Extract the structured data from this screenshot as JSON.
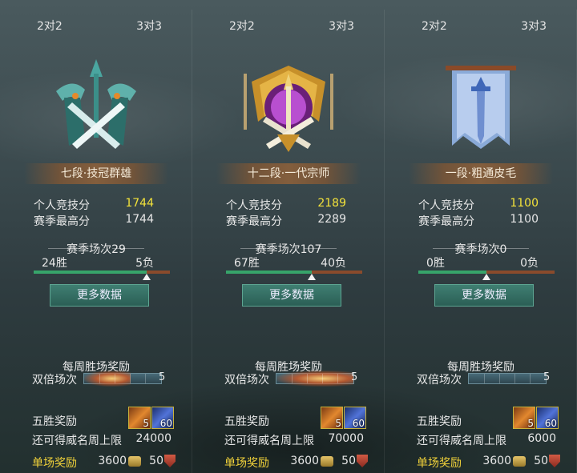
{
  "panels": [
    {
      "modes": [
        "2对2",
        "3对3"
      ],
      "rank": "七段·技冠群雄",
      "emblem": "crossed-swords-emblem",
      "score_label": "个人竞技分",
      "score": "1744",
      "max_label": "赛季最高分",
      "max_score": "1744",
      "season": "赛季场次29",
      "wins": "24胜",
      "losses": "5负",
      "win_ratio": 0.83,
      "more_button": "更多数据",
      "weekly_title": "每周胜场奖励",
      "double_label": "双倍场次",
      "double_count": "5",
      "double_progress": 0.6,
      "five_win_label": "五胜奖励",
      "item1_count": "5",
      "item2_count": "60",
      "cap_label": "还可得威名周上限",
      "cap_value": "24000",
      "single_label": "单场奖励",
      "coins": "3600",
      "shield": "50"
    },
    {
      "modes": [
        "2对2",
        "3对3"
      ],
      "rank": "十二段·一代宗师",
      "emblem": "golden-winged-emblem",
      "score_label": "个人竞技分",
      "score": "2189",
      "max_label": "赛季最高分",
      "max_score": "2289",
      "season": "赛季场次107",
      "wins": "67胜",
      "losses": "40负",
      "win_ratio": 0.63,
      "more_button": "更多数据",
      "weekly_title": "每周胜场奖励",
      "double_label": "双倍场次",
      "double_count": "5",
      "double_progress": 1.0,
      "five_win_label": "五胜奖励",
      "item1_count": "5",
      "item2_count": "60",
      "cap_label": "还可得威名周上限",
      "cap_value": "70000",
      "single_label": "单场奖励",
      "coins": "3600",
      "shield": "50"
    },
    {
      "modes": [
        "2对2",
        "3对3"
      ],
      "rank": "一段·粗通皮毛",
      "emblem": "sword-banner-emblem",
      "score_label": "个人竞技分",
      "score": "1100",
      "max_label": "赛季最高分",
      "max_score": "1100",
      "season": "赛季场次0",
      "wins": "0胜",
      "losses": "0负",
      "win_ratio": 0.5,
      "more_button": "更多数据",
      "weekly_title": "每周胜场奖励",
      "double_label": "双倍场次",
      "double_count": "5",
      "double_progress": 0.0,
      "five_win_label": "五胜奖励",
      "item1_count": "5",
      "item2_count": "60",
      "cap_label": "还可得威名周上限",
      "cap_value": "6000",
      "single_label": "单场奖励",
      "coins": "3600",
      "shield": "50"
    }
  ],
  "colors": {
    "score_highlight": "#f3e23a",
    "single_reward_label": "#f1d23a",
    "win_bar": "#37a46a",
    "loss_bar": "#8a4b2c"
  }
}
